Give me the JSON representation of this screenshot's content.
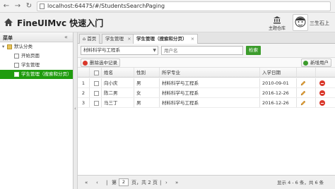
{
  "browser": {
    "url": "localhost:64475/#/StudentsSearchPaging"
  },
  "header": {
    "title": "FineUIMvc 快速入门",
    "theme_label": "主题仓库",
    "user_name": "三生石上"
  },
  "menu": {
    "title": "菜单",
    "root": "默认分类",
    "items": [
      {
        "label": "开始页面"
      },
      {
        "label": "学生管理"
      },
      {
        "label": "学生管理（搜索和分页）"
      }
    ]
  },
  "tabs": [
    {
      "label": "首页"
    },
    {
      "label": "学生管理"
    },
    {
      "label": "学生管理（搜索和分页）"
    }
  ],
  "toolbar": {
    "major_value": "材料科学与工程系",
    "search_placeholder": "用户名",
    "search_button": "检索"
  },
  "grid_toolbar": {
    "delete_label": "删除选中记录",
    "add_label": "新增用户"
  },
  "grid": {
    "columns": [
      "姓名",
      "性别",
      "所学专业",
      "入学日期"
    ],
    "rows": [
      {
        "num": "1",
        "name": "向小庆",
        "gender": "男",
        "major": "材料科学与工程系",
        "date": "2010-09-01"
      },
      {
        "num": "2",
        "name": "陈二男",
        "gender": "女",
        "major": "材料科学与工程系",
        "date": "2016-12-26"
      },
      {
        "num": "3",
        "name": "马三丁",
        "gender": "男",
        "major": "材料科学与工程系",
        "date": "2016-12-26"
      }
    ]
  },
  "pager": {
    "first": "«",
    "prev": "‹",
    "page_prefix": "第",
    "page_value": "2",
    "page_suffix": "页，共 2 页",
    "next": "›",
    "last": "»",
    "summary": "显示 4 - 6 条，共 6 条"
  },
  "colors": {
    "selected_menu": "#1f9c0e",
    "search_button": "#3c9c2c",
    "delete_icon": "#d9382b"
  }
}
